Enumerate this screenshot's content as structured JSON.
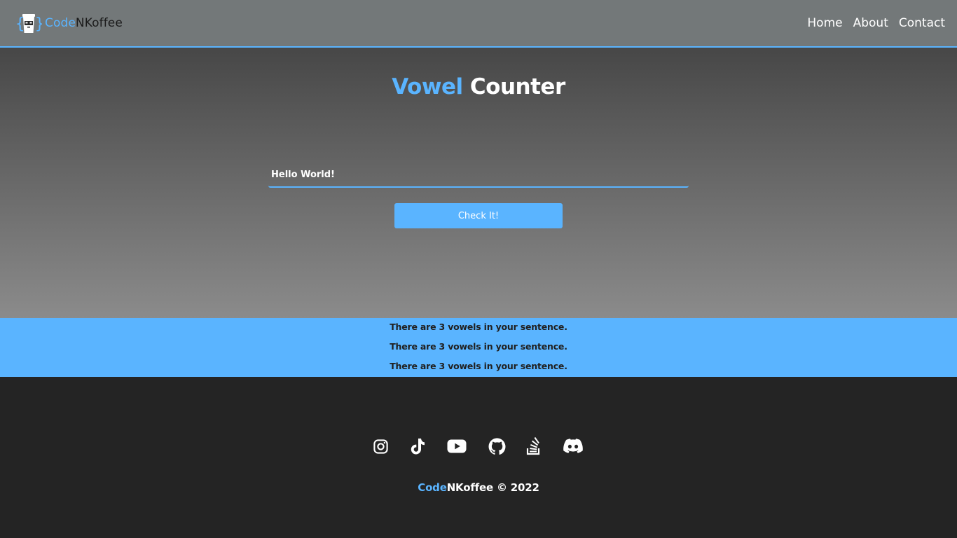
{
  "navbar": {
    "logo": {
      "code": "Code",
      "rest": "NKoffee"
    },
    "links": [
      {
        "label": "Home"
      },
      {
        "label": "About"
      },
      {
        "label": "Contact"
      }
    ]
  },
  "main": {
    "title": {
      "accent": "Vowel",
      "rest": "Counter"
    },
    "input_value": "Hello World!",
    "button_label": "Check It!"
  },
  "results": [
    "There are 3 vowels in your sentence.",
    "There are 3 vowels in your sentence.",
    "There are 3 vowels in your sentence."
  ],
  "footer": {
    "socials": [
      "instagram-icon",
      "tiktok-icon",
      "youtube-icon",
      "github-icon",
      "stackoverflow-icon",
      "discord-icon"
    ],
    "copyright": {
      "code": "Code",
      "rest": "NKoffee © 2022"
    }
  },
  "colors": {
    "accent": "#5ab4ff",
    "navbar_bg": "#737879",
    "footer_bg": "#242424"
  }
}
